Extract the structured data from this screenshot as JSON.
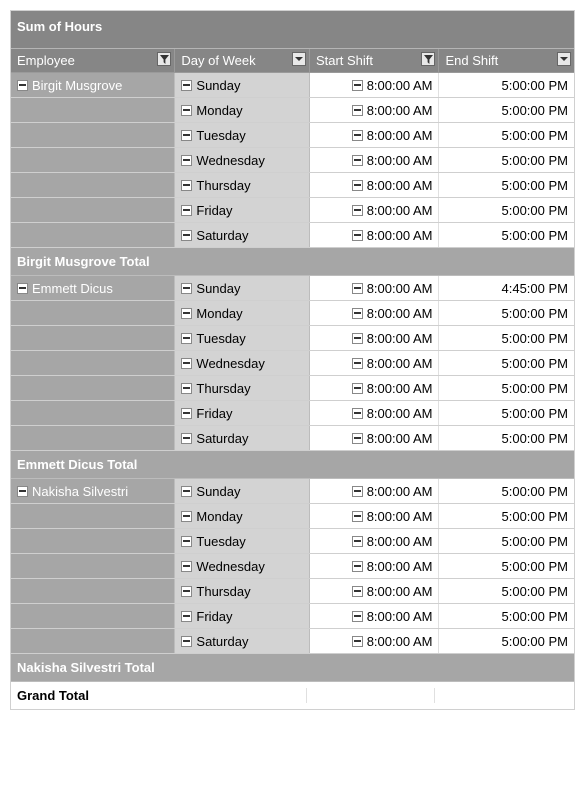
{
  "title": "Sum of Hours",
  "headers": {
    "employee": "Employee",
    "day": "Day of Week",
    "start": "Start Shift",
    "end": "End Shift"
  },
  "groups": [
    {
      "name": "Birgit Musgrove",
      "total_label": "Birgit Musgrove Total",
      "rows": [
        {
          "day": "Sunday",
          "start": "8:00:00 AM",
          "end": "5:00:00 PM"
        },
        {
          "day": "Monday",
          "start": "8:00:00 AM",
          "end": "5:00:00 PM"
        },
        {
          "day": "Tuesday",
          "start": "8:00:00 AM",
          "end": "5:00:00 PM"
        },
        {
          "day": "Wednesday",
          "start": "8:00:00 AM",
          "end": "5:00:00 PM"
        },
        {
          "day": "Thursday",
          "start": "8:00:00 AM",
          "end": "5:00:00 PM"
        },
        {
          "day": "Friday",
          "start": "8:00:00 AM",
          "end": "5:00:00 PM"
        },
        {
          "day": "Saturday",
          "start": "8:00:00 AM",
          "end": "5:00:00 PM"
        }
      ]
    },
    {
      "name": "Emmett Dicus",
      "total_label": "Emmett Dicus Total",
      "rows": [
        {
          "day": "Sunday",
          "start": "8:00:00 AM",
          "end": "4:45:00 PM"
        },
        {
          "day": "Monday",
          "start": "8:00:00 AM",
          "end": "5:00:00 PM"
        },
        {
          "day": "Tuesday",
          "start": "8:00:00 AM",
          "end": "5:00:00 PM"
        },
        {
          "day": "Wednesday",
          "start": "8:00:00 AM",
          "end": "5:00:00 PM"
        },
        {
          "day": "Thursday",
          "start": "8:00:00 AM",
          "end": "5:00:00 PM"
        },
        {
          "day": "Friday",
          "start": "8:00:00 AM",
          "end": "5:00:00 PM"
        },
        {
          "day": "Saturday",
          "start": "8:00:00 AM",
          "end": "5:00:00 PM"
        }
      ]
    },
    {
      "name": "Nakisha Silvestri",
      "total_label": "Nakisha Silvestri Total",
      "rows": [
        {
          "day": "Sunday",
          "start": "8:00:00 AM",
          "end": "5:00:00 PM"
        },
        {
          "day": "Monday",
          "start": "8:00:00 AM",
          "end": "5:00:00 PM"
        },
        {
          "day": "Tuesday",
          "start": "8:00:00 AM",
          "end": "5:00:00 PM"
        },
        {
          "day": "Wednesday",
          "start": "8:00:00 AM",
          "end": "5:00:00 PM"
        },
        {
          "day": "Thursday",
          "start": "8:00:00 AM",
          "end": "5:00:00 PM"
        },
        {
          "day": "Friday",
          "start": "8:00:00 AM",
          "end": "5:00:00 PM"
        },
        {
          "day": "Saturday",
          "start": "8:00:00 AM",
          "end": "5:00:00 PM"
        }
      ]
    }
  ],
  "grand_total_label": "Grand Total"
}
